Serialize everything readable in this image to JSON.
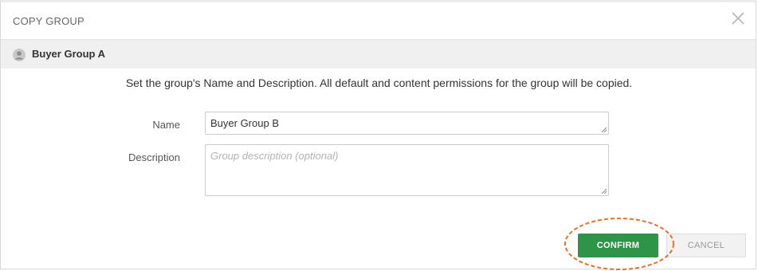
{
  "dialog": {
    "title": "COPY GROUP",
    "close_icon": "close-icon"
  },
  "group": {
    "name": "Buyer Group A",
    "avatar_icon": "user-avatar-icon"
  },
  "instructions": "Set the group's Name and Description. All default and content permissions for the group will be copied.",
  "form": {
    "name_label": "Name",
    "name_value": "Buyer Group B",
    "description_label": "Description",
    "description_placeholder": "Group description (optional)",
    "description_value": ""
  },
  "buttons": {
    "confirm_label": "CONFIRM",
    "cancel_label": "CANCEL"
  },
  "colors": {
    "confirm_bg": "#2e9447",
    "highlight_ring": "#e8702a"
  }
}
